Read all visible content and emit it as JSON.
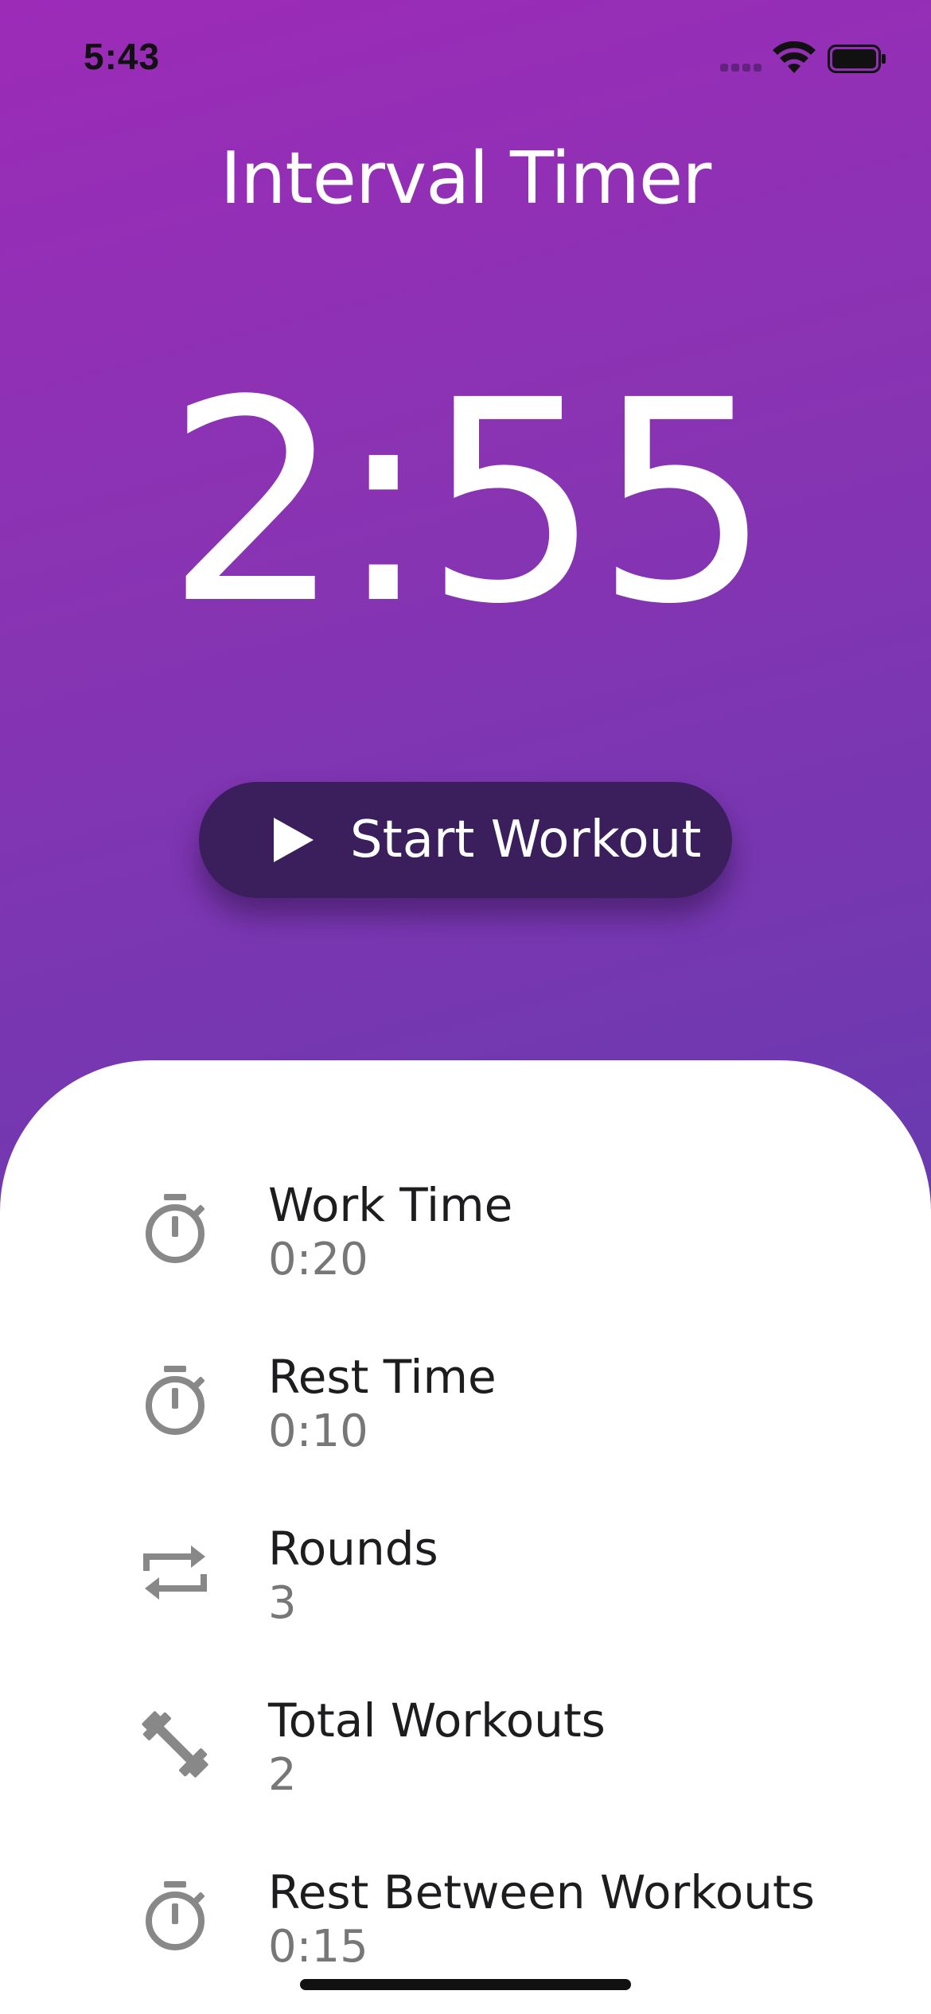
{
  "status_bar": {
    "time": "5:43"
  },
  "app": {
    "title": "Interval Timer",
    "timer": "2:55"
  },
  "start_button": {
    "label": "Start Workout",
    "icon": "play-icon"
  },
  "settings": [
    {
      "label": "Work Time",
      "value": "0:20",
      "icon": "stopwatch-icon"
    },
    {
      "label": "Rest Time",
      "value": "0:10",
      "icon": "stopwatch-icon"
    },
    {
      "label": "Rounds",
      "value": "3",
      "icon": "repeat-icon"
    },
    {
      "label": "Total Workouts",
      "value": "2",
      "icon": "dumbbell-icon"
    },
    {
      "label": "Rest Between Workouts",
      "value": "0:15",
      "icon": "stopwatch-icon"
    }
  ],
  "colors": {
    "gradient_top": "#9c2bb8",
    "gradient_bottom": "#5a44ae",
    "button_bg": "#3b1f5c",
    "icon_gray": "#888888",
    "value_gray": "#777777"
  }
}
